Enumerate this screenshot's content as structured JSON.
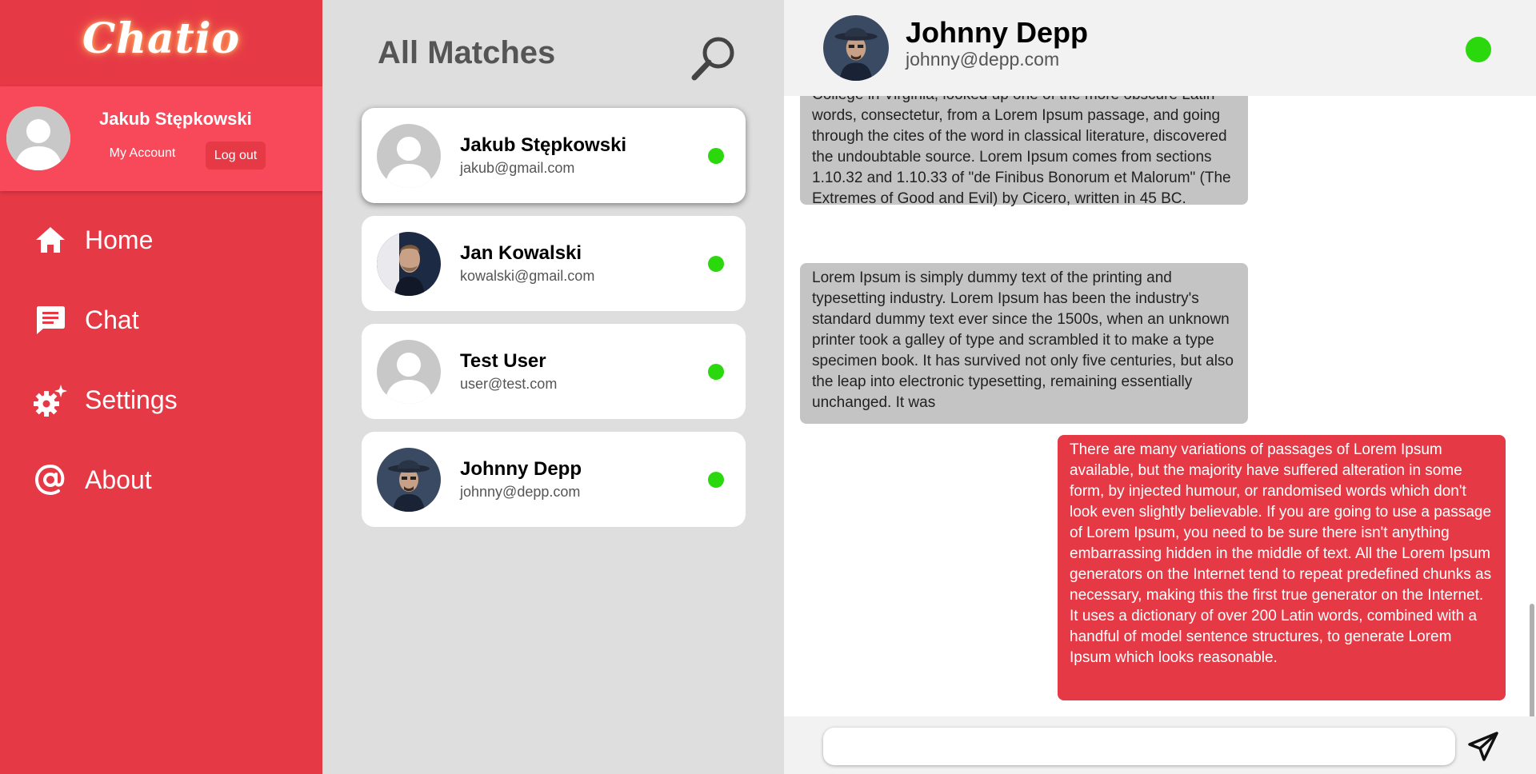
{
  "app": {
    "logo": "Chatio"
  },
  "sidebar": {
    "user": {
      "name": "Jakub Stępkowski",
      "my_account_label": "My Account",
      "logout_label": "Log out"
    },
    "nav": [
      {
        "label": "Home",
        "icon": "home-icon"
      },
      {
        "label": "Chat",
        "icon": "chat-icon"
      },
      {
        "label": "Settings",
        "icon": "gear-icon"
      },
      {
        "label": "About",
        "icon": "at-icon"
      }
    ]
  },
  "matches": {
    "title": "All Matches",
    "search_icon": "search-icon",
    "items": [
      {
        "name": "Jakub Stępkowski",
        "email": "jakub@gmail.com",
        "avatar": "default-avatar",
        "online": true
      },
      {
        "name": "Jan Kowalski",
        "email": "kowalski@gmail.com",
        "avatar": "photo-avatar",
        "online": true
      },
      {
        "name": "Test User",
        "email": "user@test.com",
        "avatar": "default-avatar",
        "online": true
      },
      {
        "name": "Johnny Depp",
        "email": "johnny@depp.com",
        "avatar": "photo-avatar",
        "online": true
      }
    ]
  },
  "chat": {
    "contact_name": "Johnny Depp",
    "contact_email": "johnny@depp.com",
    "status_color": "#2bd80e",
    "messages": [
      {
        "direction": "in",
        "text": "College in Virginia, looked up one of the more obscure Latin words, consectetur, from a Lorem Ipsum passage, and going through the cites of the word in classical literature, discovered the undoubtable source. Lorem Ipsum comes from sections 1.10.32 and 1.10.33 of \"de Finibus Bonorum et Malorum\" (The Extremes of Good and Evil) by Cicero, written in 45 BC."
      },
      {
        "direction": "in",
        "text": "Lorem Ipsum is simply dummy text of the printing and typesetting industry. Lorem Ipsum has been the industry's standard dummy text ever since the 1500s, when an unknown printer took a galley of type and scrambled it to make a type specimen book. It has survived not only five centuries, but also the leap into electronic typesetting, remaining essentially unchanged. It was"
      },
      {
        "direction": "out",
        "text": "There are many variations of passages of Lorem Ipsum available, but the majority have suffered alteration in some form, by injected humour, or randomised words which don't look even slightly believable. If you are going to use a passage of Lorem Ipsum, you need to be sure there isn't anything embarrassing hidden in the middle of text. All the Lorem Ipsum generators on the Internet tend to repeat predefined chunks as necessary, making this the first true generator on the Internet. It uses a dictionary of over 200 Latin words, combined with a handful of model sentence structures, to generate Lorem Ipsum which looks reasonable."
      }
    ],
    "input": {
      "value": "",
      "placeholder": ""
    },
    "send_icon": "send-icon"
  },
  "colors": {
    "brand": "#e63946",
    "brand_light": "#f7495a",
    "online": "#2bd80e",
    "incoming_bubble": "#c4c4c4"
  }
}
